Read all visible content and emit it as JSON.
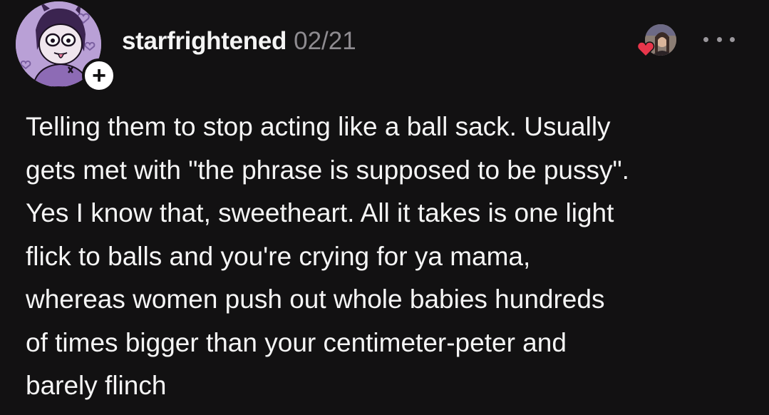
{
  "post": {
    "username": "starfrightened",
    "date": "02/21",
    "follow_label": "+",
    "body_lines": [
      "Telling them to stop acting like a ball sack. Usually",
      "gets met with \"the phrase is supposed to be pussy\".",
      "Yes I know that, sweetheart. All it takes is one light",
      "flick to balls and you're crying for ya mama,",
      "whereas women push out whole babies hundreds",
      "of times bigger than your centimeter-peter and",
      "barely flinch"
    ]
  },
  "icons": {
    "avatar": "cartoon-avatar-icon",
    "follow": "plus-icon",
    "liked_by": "heart-icon",
    "more": "more-dots-icon"
  },
  "colors": {
    "background": "#121112",
    "text": "#f5f5f5",
    "muted": "#8e8b90",
    "heart": "#e8364b",
    "avatar_bg": "#b9a0d6"
  }
}
